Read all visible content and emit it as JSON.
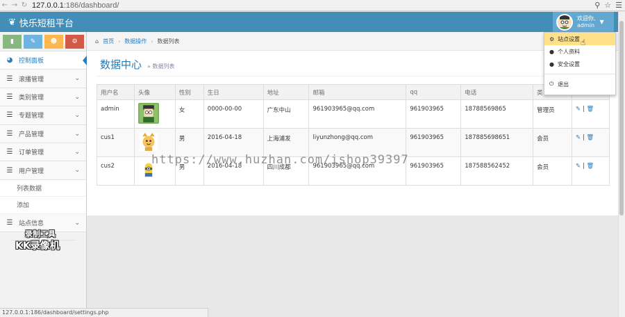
{
  "browser": {
    "url_host": "127.0.0.1",
    "url_path": ":186/dashboard/",
    "status_url": "127.0.0.1:186/dashboard/settings.php"
  },
  "navbar": {
    "brand": "快乐短租平台",
    "welcome": "欢迎你,",
    "username": "admin"
  },
  "user_dropdown": {
    "items": [
      {
        "icon": "gear-icon",
        "label": "站点设置"
      },
      {
        "icon": "user-icon",
        "label": "个人资料"
      },
      {
        "icon": "user-lock-icon",
        "label": "安全设置"
      },
      {
        "icon": "power-icon",
        "label": "退出"
      }
    ]
  },
  "sidebar": {
    "shortcut_colors": [
      "#87b87f",
      "#6fb3e0",
      "#ffb752",
      "#d15b47"
    ],
    "items": [
      {
        "label": "控制面板",
        "active": true
      },
      {
        "label": "滚播管理"
      },
      {
        "label": "类别管理"
      },
      {
        "label": "专题管理"
      },
      {
        "label": "产品管理"
      },
      {
        "label": "订单管理"
      },
      {
        "label": "用户管理",
        "open": true
      }
    ],
    "submenu": [
      "列表数据",
      "添加"
    ],
    "last_item": "站点信息",
    "tool_watermark_1": "录制工具",
    "tool_watermark_2": "KK录像机"
  },
  "breadcrumb": {
    "home": "首页",
    "level1": "数据操作",
    "level2": "数据列表"
  },
  "page": {
    "title": "数据中心",
    "subtitle": "» 数据列表"
  },
  "table": {
    "headers": [
      "用户名",
      "头像",
      "性别",
      "生日",
      "地址",
      "邮箱",
      "qq",
      "电话",
      "类",
      ""
    ],
    "rows": [
      {
        "username": "admin",
        "gender": "女",
        "birthday": "0000-00-00",
        "address": "广东中山",
        "email": "961903965@qq.com",
        "qq": "961903965",
        "phone": "18788569865",
        "type": "管理员"
      },
      {
        "username": "cus1",
        "gender": "男",
        "birthday": "2016-04-18",
        "address": "上海浦发",
        "email": "liyunzhong@qq.com",
        "qq": "961903965",
        "phone": "187885698651",
        "type": "会员"
      },
      {
        "username": "cus2",
        "gender": "男",
        "birthday": "2016-04-18",
        "address": "四川成都",
        "email": "961903965@qq.com",
        "qq": "961903965",
        "phone": "187588562452",
        "type": "会员"
      }
    ]
  },
  "watermark": "https://www.huzhan.com/ishop39397"
}
